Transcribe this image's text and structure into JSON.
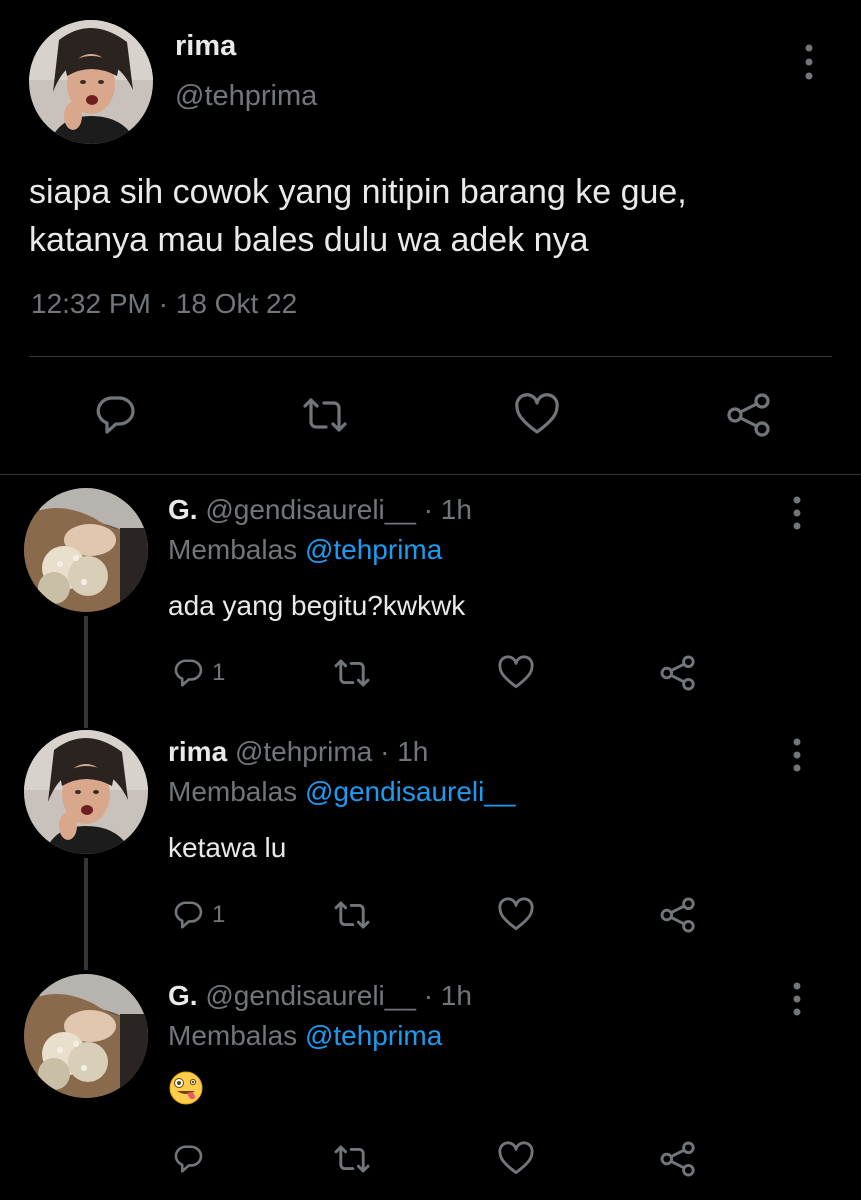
{
  "main_tweet": {
    "name": "rima",
    "handle": "@tehprima",
    "text_lines": [
      "siapa sih cowok yang nitipin barang ke gue,",
      "katanya mau bales dulu wa adek nya"
    ],
    "time": "12:32 PM",
    "separator": "·",
    "date": "18 Okt 22",
    "actions": [
      "reply-icon",
      "retweet-icon",
      "like-icon",
      "share-icon"
    ]
  },
  "replies": [
    {
      "name": "G.",
      "handle": "@gendisaureli__",
      "separator": "·",
      "time": "1h",
      "replying_label": "Membalas",
      "replying_to": "@tehprima",
      "text": "ada yang begitu?kwkwk",
      "reply_count": "1"
    },
    {
      "name": "rima",
      "handle": "@tehprima",
      "separator": "·",
      "time": "1h",
      "replying_label": "Membalas",
      "replying_to": "@gendisaureli__",
      "text": "ketawa lu",
      "reply_count": "1"
    },
    {
      "name": "G.",
      "handle": "@gendisaureli__",
      "separator": "·",
      "time": "1h",
      "replying_label": "Membalas",
      "replying_to": "@tehprima",
      "text": "🤪",
      "reply_count": ""
    }
  ],
  "colors": {
    "background": "#000000",
    "primary_text": "#e7e9ea",
    "secondary_text": "#71767b",
    "mention": "#1d9bf0",
    "divider": "#2f3336"
  }
}
